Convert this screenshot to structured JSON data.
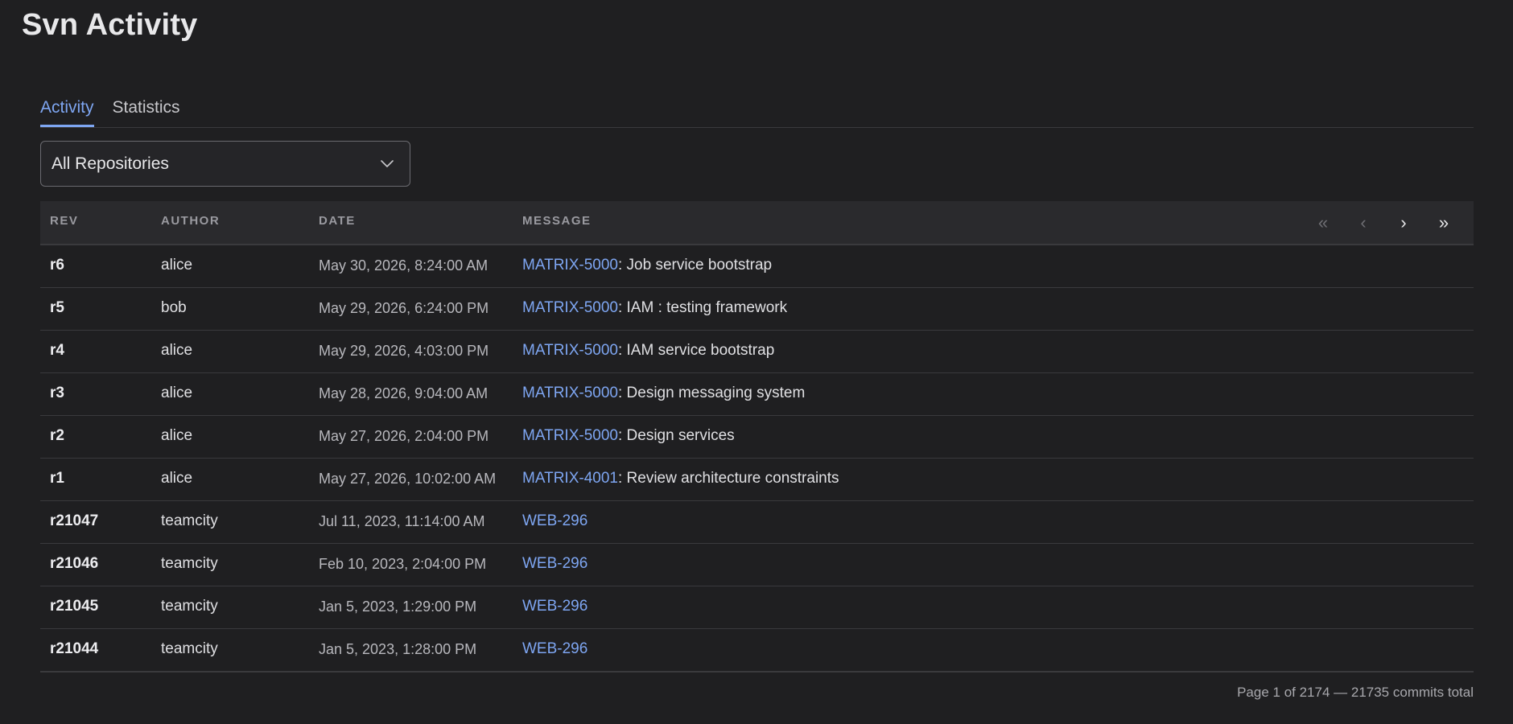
{
  "page": {
    "title": "Svn Activity"
  },
  "tabs": [
    {
      "label": "Activity",
      "active": true
    },
    {
      "label": "Statistics",
      "active": false
    }
  ],
  "repo_select": {
    "value": "All Repositories"
  },
  "table": {
    "headers": {
      "rev": "REV",
      "author": "AUTHOR",
      "date": "DATE",
      "message": "MESSAGE"
    },
    "pager": {
      "first": "«",
      "prev": "‹",
      "next": "›",
      "last": "»"
    },
    "rows": [
      {
        "rev": "r6",
        "author": "alice",
        "date": "May 30, 2026, 8:24:00 AM",
        "issue": "MATRIX-5000",
        "message": ": Job service bootstrap"
      },
      {
        "rev": "r5",
        "author": "bob",
        "date": "May 29, 2026, 6:24:00 PM",
        "issue": "MATRIX-5000",
        "message": ": IAM : testing framework"
      },
      {
        "rev": "r4",
        "author": "alice",
        "date": "May 29, 2026, 4:03:00 PM",
        "issue": "MATRIX-5000",
        "message": ": IAM service bootstrap"
      },
      {
        "rev": "r3",
        "author": "alice",
        "date": "May 28, 2026, 9:04:00 AM",
        "issue": "MATRIX-5000",
        "message": ": Design messaging system"
      },
      {
        "rev": "r2",
        "author": "alice",
        "date": "May 27, 2026, 2:04:00 PM",
        "issue": "MATRIX-5000",
        "message": ": Design services"
      },
      {
        "rev": "r1",
        "author": "alice",
        "date": "May 27, 2026, 10:02:00 AM",
        "issue": "MATRIX-4001",
        "message": ": Review architecture constraints"
      },
      {
        "rev": "r21047",
        "author": "teamcity",
        "date": "Jul 11, 2023, 11:14:00 AM",
        "issue": "WEB-296",
        "message": ""
      },
      {
        "rev": "r21046",
        "author": "teamcity",
        "date": "Feb 10, 2023, 2:04:00 PM",
        "issue": "WEB-296",
        "message": ""
      },
      {
        "rev": "r21045",
        "author": "teamcity",
        "date": "Jan 5, 2023, 1:29:00 PM",
        "issue": "WEB-296",
        "message": ""
      },
      {
        "rev": "r21044",
        "author": "teamcity",
        "date": "Jan 5, 2023, 1:28:00 PM",
        "issue": "WEB-296",
        "message": ""
      }
    ]
  },
  "footer": {
    "summary": "Page 1 of 2174 — 21735 commits total"
  },
  "colors": {
    "background": "#1f1f21",
    "accent": "#7ea6f2",
    "header_bg": "#2a2a2d",
    "divider": "#3a3a3d"
  }
}
